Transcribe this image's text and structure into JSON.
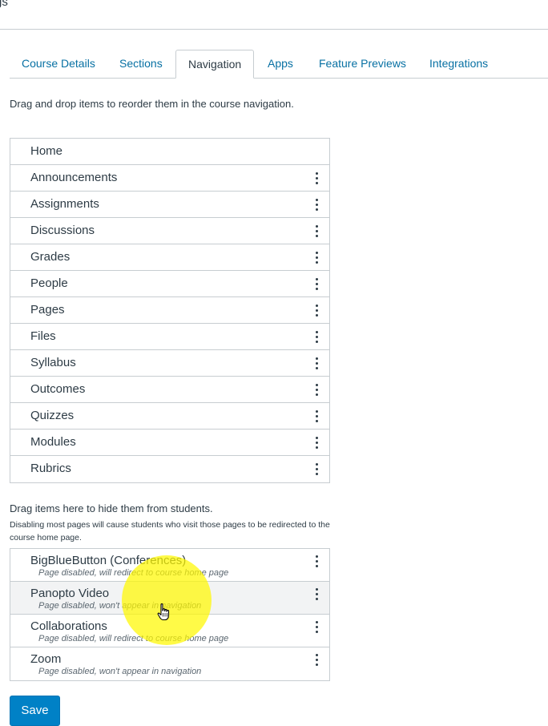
{
  "header": {
    "title_fragment": "gs"
  },
  "tabs": [
    {
      "label": "Course Details",
      "active": false
    },
    {
      "label": "Sections",
      "active": false
    },
    {
      "label": "Navigation",
      "active": true
    },
    {
      "label": "Apps",
      "active": false
    },
    {
      "label": "Feature Previews",
      "active": false
    },
    {
      "label": "Integrations",
      "active": false
    }
  ],
  "instructions": "Drag and drop items to reorder them in the course navigation.",
  "nav_items": [
    {
      "label": "Home",
      "menu_icon": ""
    },
    {
      "label": "Announcements",
      "menu_icon": "kebab-icon"
    },
    {
      "label": "Assignments",
      "menu_icon": "kebab-icon"
    },
    {
      "label": "Discussions",
      "menu_icon": "kebab-icon"
    },
    {
      "label": "Grades",
      "menu_icon": "kebab-icon"
    },
    {
      "label": "People",
      "menu_icon": "kebab-icon"
    },
    {
      "label": "Pages",
      "menu_icon": "kebab-icon"
    },
    {
      "label": "Files",
      "menu_icon": "kebab-icon"
    },
    {
      "label": "Syllabus",
      "menu_icon": "kebab-icon"
    },
    {
      "label": "Outcomes",
      "menu_icon": "kebab-icon"
    },
    {
      "label": "Quizzes",
      "menu_icon": "kebab-icon"
    },
    {
      "label": "Modules",
      "menu_icon": "kebab-icon"
    },
    {
      "label": "Rubrics",
      "menu_icon": "kebab-icon"
    }
  ],
  "hidden_section": {
    "heading": "Drag items here to hide them from students.",
    "note": "Disabling most pages will cause students who visit those pages to be redirected to the course home page.",
    "items": [
      {
        "label": "BigBlueButton (Conferences)",
        "status": "Page disabled, will redirect to course home page"
      },
      {
        "label": "Panopto Video",
        "status": "Page disabled, won't appear in navigation"
      },
      {
        "label": "Collaborations",
        "status": "Page disabled, will redirect to course home page"
      },
      {
        "label": "Zoom",
        "status": "Page disabled, won't appear in navigation"
      }
    ]
  },
  "save_label": "Save",
  "colors": {
    "link": "#0770a3",
    "text": "#2d3b45",
    "border": "#c7cdd1",
    "save_button": "#0081c6",
    "cursor_highlight": "#fff800"
  }
}
